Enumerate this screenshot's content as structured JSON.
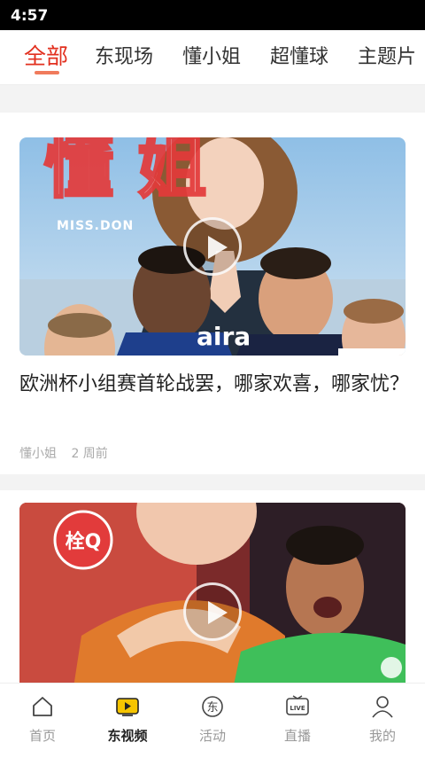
{
  "status_bar": {
    "time": "4:57"
  },
  "tabs": [
    {
      "label": "全部",
      "active": true
    },
    {
      "label": "东现场"
    },
    {
      "label": "懂小姐"
    },
    {
      "label": "超懂球"
    },
    {
      "label": "主题片"
    }
  ],
  "videos": [
    {
      "title": "欧洲杯小组赛首轮战罢，哪家欢喜，哪家忧？",
      "author": "懂小姐",
      "time": "2 周前",
      "thumb_big_text": "懂    姐",
      "thumb_sub_text": "MISS.DON",
      "thumb_shirt_text": "aira"
    },
    {
      "badge_text": "栓Q"
    }
  ],
  "bottom_nav": [
    {
      "label": "首页",
      "icon": "home-icon"
    },
    {
      "label": "东视频",
      "icon": "video-icon",
      "active": true
    },
    {
      "label": "活动",
      "icon": "activity-icon"
    },
    {
      "label": "直播",
      "icon": "live-icon",
      "icon_text": "LIVE"
    },
    {
      "label": "我的",
      "icon": "user-icon"
    }
  ],
  "colors": {
    "accent": "#e2301f",
    "video_icon": "#f5c400"
  }
}
